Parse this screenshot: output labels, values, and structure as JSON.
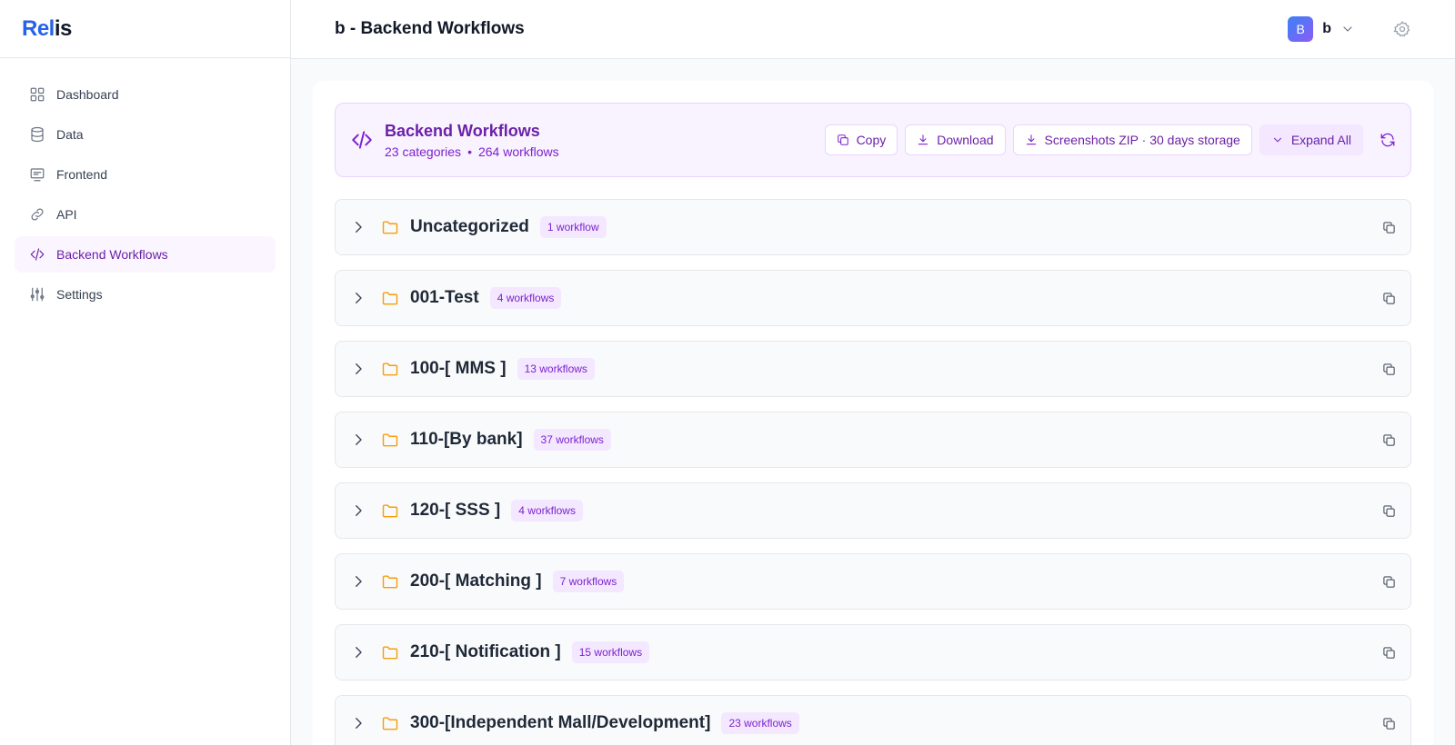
{
  "logo": {
    "part1": "Rel",
    "part2": "is"
  },
  "sidebar": {
    "items": [
      {
        "label": "Dashboard",
        "icon": "grid-icon"
      },
      {
        "label": "Data",
        "icon": "database-icon"
      },
      {
        "label": "Frontend",
        "icon": "monitor-icon"
      },
      {
        "label": "API",
        "icon": "link-icon"
      },
      {
        "label": "Backend Workflows",
        "icon": "code-icon",
        "active": true
      },
      {
        "label": "Settings",
        "icon": "sliders-icon"
      }
    ]
  },
  "header": {
    "title": "b - Backend Workflows",
    "avatar_letter": "B",
    "user_name": "b"
  },
  "summary": {
    "title": "Backend Workflows",
    "categories_text": "23 categories",
    "separator": "•",
    "workflows_text": "264 workflows",
    "actions": {
      "copy": "Copy",
      "download": "Download",
      "screenshots": "Screenshots ZIP · 30 days storage",
      "expand": "Expand All"
    }
  },
  "categories": [
    {
      "name": "Uncategorized",
      "count": "1 workflow"
    },
    {
      "name": "001-Test",
      "count": "4 workflows"
    },
    {
      "name": "100-[ MMS ]",
      "count": "13 workflows"
    },
    {
      "name": "110-[By bank]",
      "count": "37 workflows"
    },
    {
      "name": "120-[ SSS ]",
      "count": "4 workflows"
    },
    {
      "name": "200-[ Matching ]",
      "count": "7 workflows"
    },
    {
      "name": "210-[ Notification ]",
      "count": "15 workflows"
    },
    {
      "name": "300-[Independent Mall/Development]",
      "count": "23 workflows"
    }
  ],
  "colors": {
    "accent": "#7e22ce",
    "brand": "#2563eb",
    "folder": "#f59e0b"
  }
}
